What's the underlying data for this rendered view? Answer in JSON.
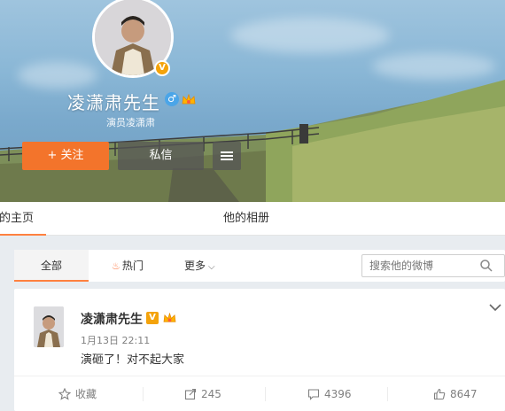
{
  "profile": {
    "name": "凌潇肃先生",
    "subtitle": "演员凌潇肃",
    "verified_badge": "V",
    "gender_icon": "male-icon",
    "follow_label": "关注",
    "message_label": "私信"
  },
  "tabs": {
    "home": "他的主页",
    "album": "他的相册"
  },
  "filters": {
    "all": "全部",
    "hot": "热门",
    "more": "更多",
    "search_placeholder": "搜索他的微博"
  },
  "post": {
    "author": "凌潇肃先生",
    "verified_badge": "V",
    "time": "1月13日 22:11",
    "text": "演砸了！对不起大家",
    "actions": {
      "favorite": "收藏",
      "repost": "245",
      "comment": "4396",
      "like": "8647"
    }
  },
  "colors": {
    "accent": "#ff8140",
    "follow_button": "#f3742b",
    "verified": "#f4a30b"
  }
}
